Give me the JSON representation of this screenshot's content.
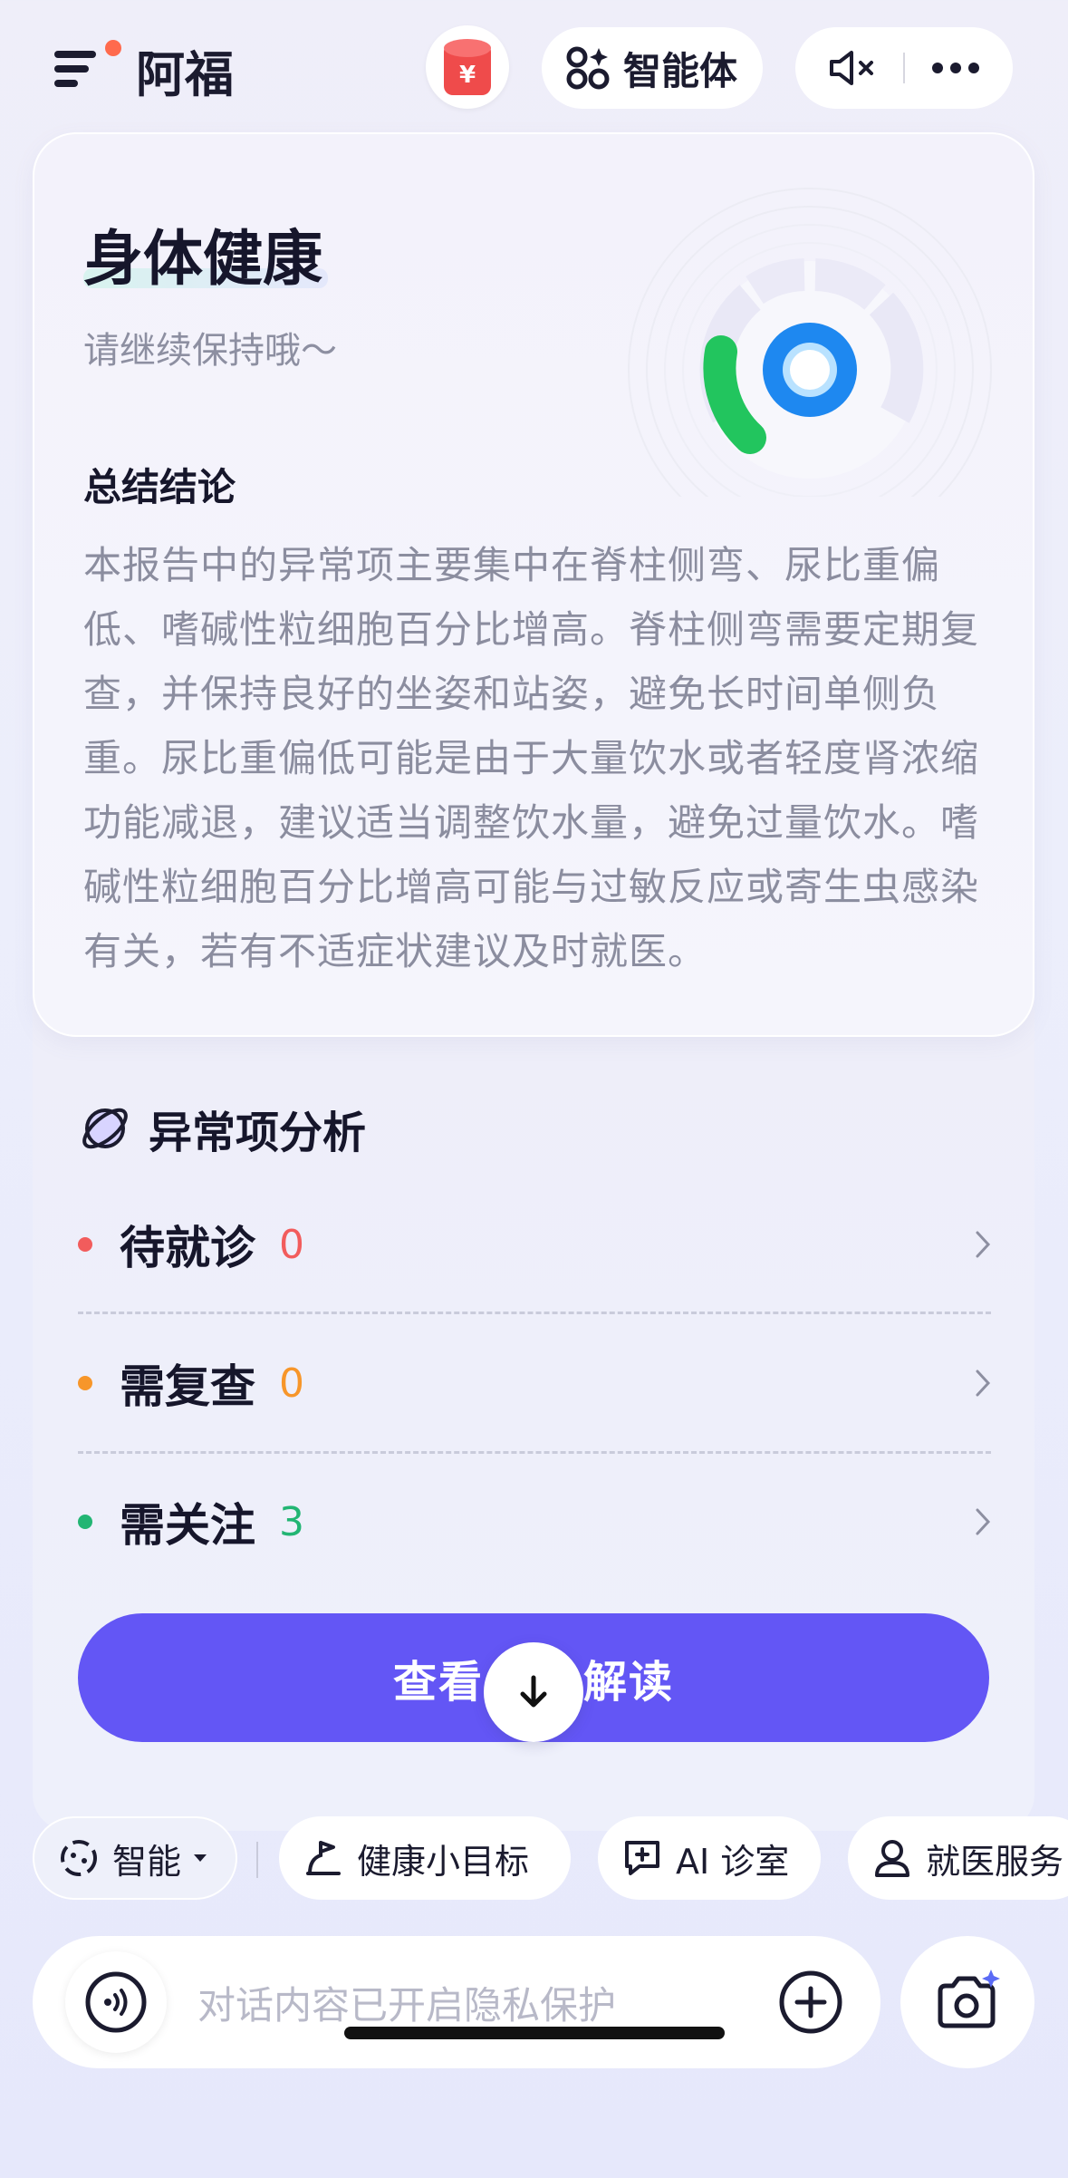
{
  "header": {
    "app_title": "阿福",
    "agent_label": "智能体",
    "icons": [
      "menu-icon",
      "red-packet-icon",
      "agent-icon",
      "mute-icon",
      "more-icon"
    ]
  },
  "report": {
    "title": "身体健康",
    "subtitle": "请继续保持哦～",
    "summary_heading": "总结结论",
    "summary_text": "本报告中的异常项主要集中在脊柱侧弯、尿比重偏低、嗜碱性粒细胞百分比增高。脊柱侧弯需要定期复查，并保持良好的坐姿和站姿，避免长时间单侧负重。尿比重偏低可能是由于大量饮水或者轻度肾浓缩功能减退，建议适当调整饮水量，避免过量饮水。嗜碱性粒细胞百分比增高可能与过敏反应或寄生虫感染有关，若有不适症状建议及时就医。"
  },
  "analysis": {
    "title": "异常项分析",
    "items": [
      {
        "label": "待就诊",
        "count": "0",
        "color": "#f25c5c"
      },
      {
        "label": "需复查",
        "count": "0",
        "color": "#f7962a"
      },
      {
        "label": "需关注",
        "count": "3",
        "color": "#22b573"
      }
    ],
    "button_label_left": "查看",
    "button_label_right": "解读"
  },
  "chips": {
    "mode": "智能",
    "goal": "健康小目标",
    "ai_clinic": "AI 诊室",
    "medical": "就医服务"
  },
  "input": {
    "placeholder": "对话内容已开启隐私保护"
  },
  "colors": {
    "accent": "#6356f5",
    "gauge_green": "#22c55e",
    "gauge_blue": "#1e88f0"
  }
}
